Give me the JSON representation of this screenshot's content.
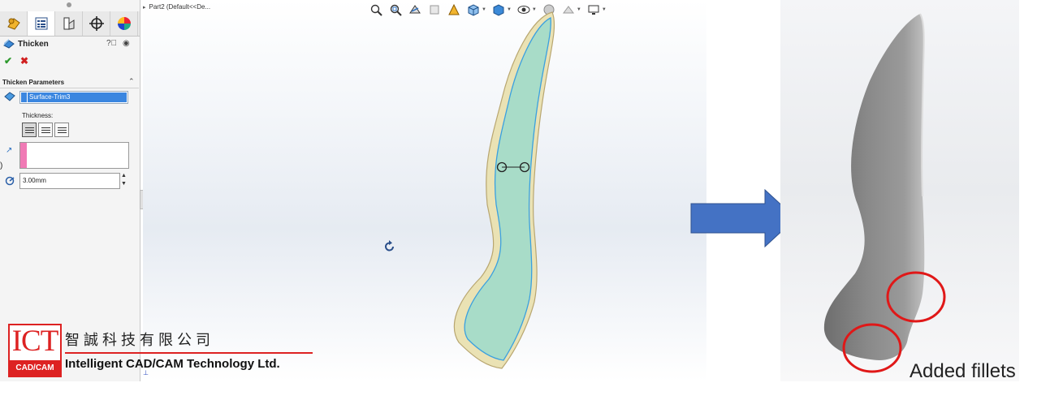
{
  "property_manager": {
    "title": "Thicken",
    "group_header": "Thicken Parameters",
    "face_selection": "Surface-Trim3",
    "thickness_label": "Thickness:",
    "thickness_value": "3.00mm"
  },
  "graphics": {
    "tree_crumb": "Part2  (Default<<De..."
  },
  "result": {
    "caption": "Added fillets"
  },
  "logo": {
    "mark": "ICT",
    "sub": "CAD/CAM",
    "name_cn": "智誠科技有限公司",
    "name_en": "Intelligent CAD/CAM Technology Ltd."
  },
  "colors": {
    "accent_red": "#dd2222",
    "arrow_blue": "#4472c4",
    "surface_green": "#a8dcc8",
    "selection_blue": "#3a86e0"
  },
  "icons": [
    "feature-manager-icon",
    "property-manager-icon",
    "configuration-manager-icon",
    "dimxpert-icon",
    "display-manager-icon",
    "thicken-icon",
    "help-icon",
    "pin-icon",
    "ok-check-icon",
    "cancel-x-icon",
    "face-select-icon",
    "direction-arrow-icon",
    "rotate-cursor-icon",
    "zoom-fit-icon",
    "zoom-area-icon",
    "previous-view-icon",
    "section-view-icon",
    "view-orientation-icon",
    "display-style-icon",
    "hide-show-icon",
    "edit-appearance-icon",
    "apply-scene-icon",
    "view-settings-icon"
  ]
}
